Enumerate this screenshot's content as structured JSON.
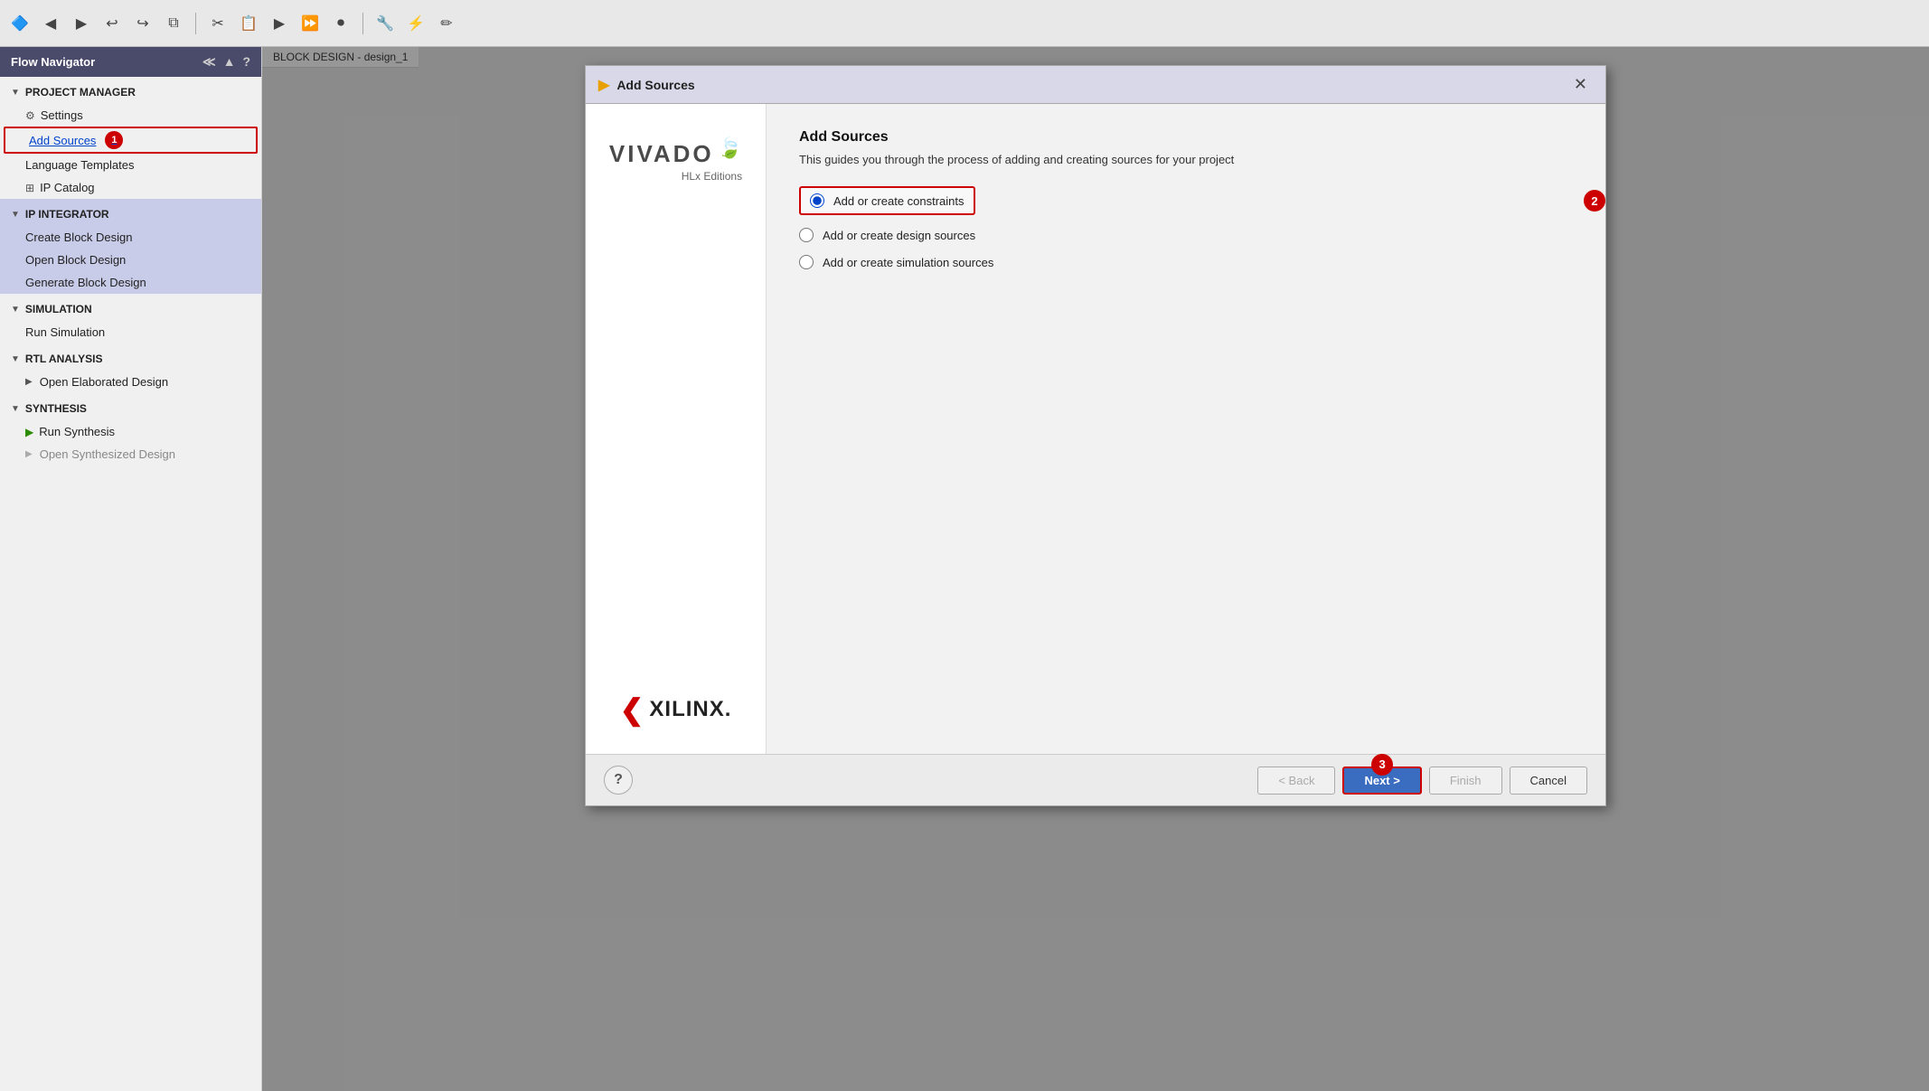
{
  "toolbar": {
    "icons": [
      "◀",
      "▶",
      "↩",
      "↪",
      "⧉",
      "✂",
      "📋",
      "▶",
      "⏩",
      "⏺",
      "🔧",
      "⚡",
      "✏"
    ]
  },
  "sidebar": {
    "title": "Flow Navigator",
    "sections": [
      {
        "id": "project-manager",
        "label": "PROJECT MANAGER",
        "expanded": true,
        "items": [
          {
            "id": "settings",
            "label": "Settings",
            "icon": "⚙",
            "has_icon": true
          },
          {
            "id": "add-sources",
            "label": "Add Sources",
            "highlighted": true,
            "badge": "1"
          },
          {
            "id": "language-templates",
            "label": "Language Templates",
            "has_icon": false
          },
          {
            "id": "ip-catalog",
            "label": "IP Catalog",
            "icon": "⊞",
            "has_icon": true
          }
        ]
      },
      {
        "id": "ip-integrator",
        "label": "IP INTEGRATOR",
        "expanded": true,
        "active": true,
        "items": [
          {
            "id": "create-block-design",
            "label": "Create Block Design"
          },
          {
            "id": "open-block-design",
            "label": "Open Block Design"
          },
          {
            "id": "generate-block-design",
            "label": "Generate Block Design"
          }
        ]
      },
      {
        "id": "simulation",
        "label": "SIMULATION",
        "expanded": true,
        "items": [
          {
            "id": "run-simulation",
            "label": "Run Simulation"
          }
        ]
      },
      {
        "id": "rtl-analysis",
        "label": "RTL ANALYSIS",
        "expanded": true,
        "items": [
          {
            "id": "open-elaborated",
            "label": "Open Elaborated Design",
            "expandable": true
          }
        ]
      },
      {
        "id": "synthesis",
        "label": "SYNTHESIS",
        "expanded": true,
        "items": [
          {
            "id": "run-synthesis",
            "label": "Run Synthesis",
            "play_icon": true
          },
          {
            "id": "open-synthesized",
            "label": "Open Synthesized Design",
            "expandable": true,
            "greyed": true
          }
        ]
      }
    ]
  },
  "background": {
    "label": "BLOCK DESIGN - design_1"
  },
  "modal": {
    "title": "Add Sources",
    "title_icon": "▶",
    "close_label": "✕",
    "vivado": {
      "logo_text": "VIVADO",
      "hlx_text": "HLx Editions"
    },
    "xilinx": {
      "symbol": "❮",
      "text": "XILINX."
    },
    "content": {
      "heading": "Add Sources",
      "description": "This guides you through the process of adding and creating sources for your project",
      "options": [
        {
          "id": "constraints",
          "label": "Add or create constraints",
          "selected": true,
          "step_badge": "2"
        },
        {
          "id": "design-sources",
          "label": "Add or create design sources",
          "selected": false
        },
        {
          "id": "simulation-sources",
          "label": "Add or create simulation sources",
          "selected": false
        }
      ]
    },
    "footer": {
      "help_label": "?",
      "back_label": "< Back",
      "next_label": "Next >",
      "finish_label": "Finish",
      "cancel_label": "Cancel",
      "step3_badge": "3"
    }
  }
}
